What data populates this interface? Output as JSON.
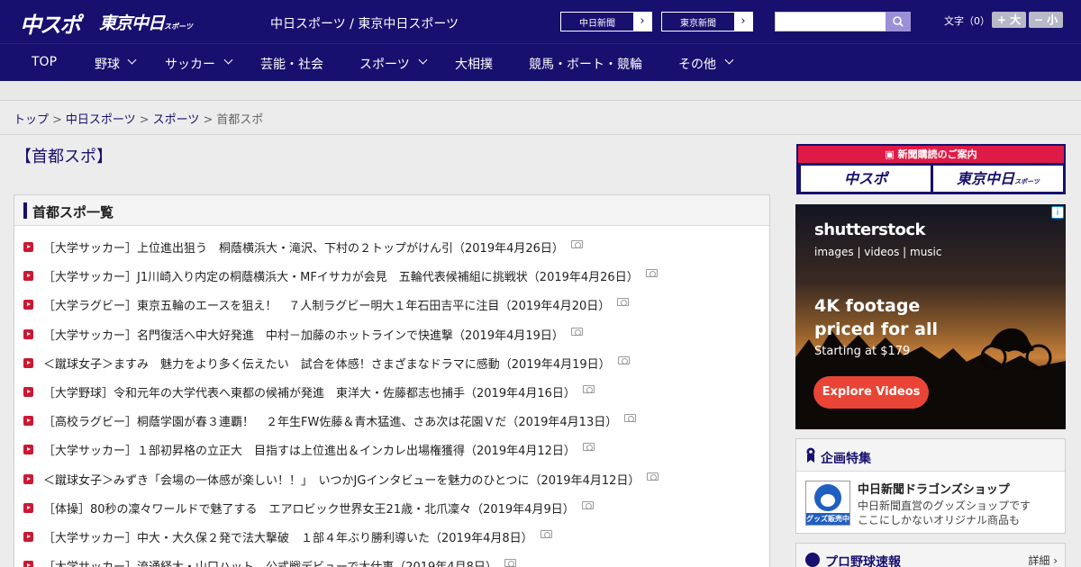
{
  "header": {
    "logo_chuspo": "中スポ",
    "logo_tokyo": "東京中日",
    "logo_tokyo_sub": "スポーツ",
    "site_title": "中日スポーツ / 東京中日スポーツ",
    "ext_links": [
      "中日新聞",
      "東京新聞"
    ],
    "font_label": "文字（0）",
    "font_plus": "+ 大",
    "font_minus": "− 小"
  },
  "nav": {
    "items": [
      "TOP",
      "野球",
      "サッカー",
      "芸能・社会",
      "スポーツ",
      "大相撲",
      "競馬・ボート・競輪",
      "その他"
    ]
  },
  "breadcrumb": {
    "items": [
      "トップ",
      "中日スポーツ",
      "スポーツ"
    ],
    "current": "首都スポ"
  },
  "page_title": "【首都スポ】",
  "list_panel": {
    "title": "首都スポ一覧",
    "items": [
      "［大学サッカー］上位進出狙う　桐蔭横浜大・滝沢、下村の２トップがけん引（2019年4月26日）",
      "［大学サッカー］J1川崎入り内定の桐蔭横浜大・MFイサカが会見　五輪代表候補組に挑戦状（2019年4月26日）",
      "［大学ラグビー］東京五輪のエースを狙え！　７人制ラグビー明大１年石田吉平に注目（2019年4月20日）",
      "［大学サッカー］名門復活へ中大好発進　中村－加藤のホットラインで快進撃（2019年4月19日）",
      "＜蹴球女子＞ますみ　魅力をより多く伝えたい　試合を体感！さまざまなドラマに感動（2019年4月19日）",
      "［大学野球］令和元年の大学代表へ東都の候補が発進　東洋大・佐藤都志也捕手（2019年4月16日）",
      "［高校ラグビー］桐蔭学園が春３連覇！　２年生FW佐藤＆青木猛進、さあ次は花園Ｖだ（2019年4月13日）",
      "［大学サッカー］１部初昇格の立正大　目指すは上位進出＆インカレ出場権獲得（2019年4月12日）",
      "＜蹴球女子＞みずき「会場の一体感が楽しい！！」　いつかJGインタビューを魅力のひとつに（2019年4月12日）",
      "［体操］80秒の凜々ワールドで魅了する　エアロビック世界女王21歳・北爪凜々（2019年4月9日）",
      "［大学サッカー］中大・大久保２発で法大撃破　１部４年ぶり勝利導いた（2019年4月8日）",
      "［大学サッカー］流通経大・山口ハット　公式戦デビューで大仕事（2019年4月8日）"
    ]
  },
  "sidebar": {
    "subscription": {
      "header": "新聞購読のご案内",
      "btn_chuspo": "中スポ",
      "btn_tokyo": "東京中日",
      "btn_tokyo_sub": "スポーツ"
    },
    "ad": {
      "brand": "shutterstock",
      "sub": "images  |  videos  |  music",
      "headline1": "4K footage",
      "headline2": "priced for all",
      "price": "Starting at $179",
      "cta": "Explore Videos",
      "info": "i"
    },
    "feature": {
      "title": "企画特集",
      "item_title": "中日新聞ドラゴンズショップ",
      "item_desc1": "中日新聞直営のグッズショップです",
      "item_desc2": "ここにしかないオリジナル商品も",
      "thumb_label": "グッズ販売中"
    },
    "baseball": {
      "title": "プロ野球速報",
      "more": "詳細 ›"
    }
  },
  "colors": {
    "brand_navy": "#17106e",
    "accent_red": "#cc1833"
  }
}
